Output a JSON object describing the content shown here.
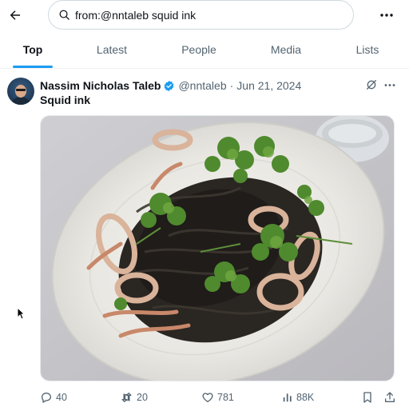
{
  "search": {
    "query": "from:@nntaleb squid ink"
  },
  "tabs": [
    {
      "label": "Top"
    },
    {
      "label": "Latest"
    },
    {
      "label": "People"
    },
    {
      "label": "Media"
    },
    {
      "label": "Lists"
    }
  ],
  "active_tab": "Top",
  "post": {
    "author_name": "Nassim Nicholas Taleb",
    "handle": "@nntaleb",
    "separator": "·",
    "date": "Jun 21, 2024",
    "text": "Squid ink",
    "image_alt": "Plate of squid ink pasta with squid rings and cilantro"
  },
  "actions": {
    "replies": "40",
    "reposts": "20",
    "likes": "781",
    "views": "88K"
  },
  "icons": {
    "back": "back-arrow-icon",
    "search": "search-icon",
    "more": "more-icon",
    "verified": "verified-badge-icon",
    "grok": "grok-icon",
    "reply": "reply-icon",
    "repost": "repost-icon",
    "like": "like-icon",
    "views": "views-icon",
    "bookmark": "bookmark-icon",
    "share": "share-icon"
  },
  "colors": {
    "accent": "#1d9bf0",
    "text_primary": "#0f1419",
    "text_secondary": "#536471",
    "border": "#cfd9de"
  }
}
